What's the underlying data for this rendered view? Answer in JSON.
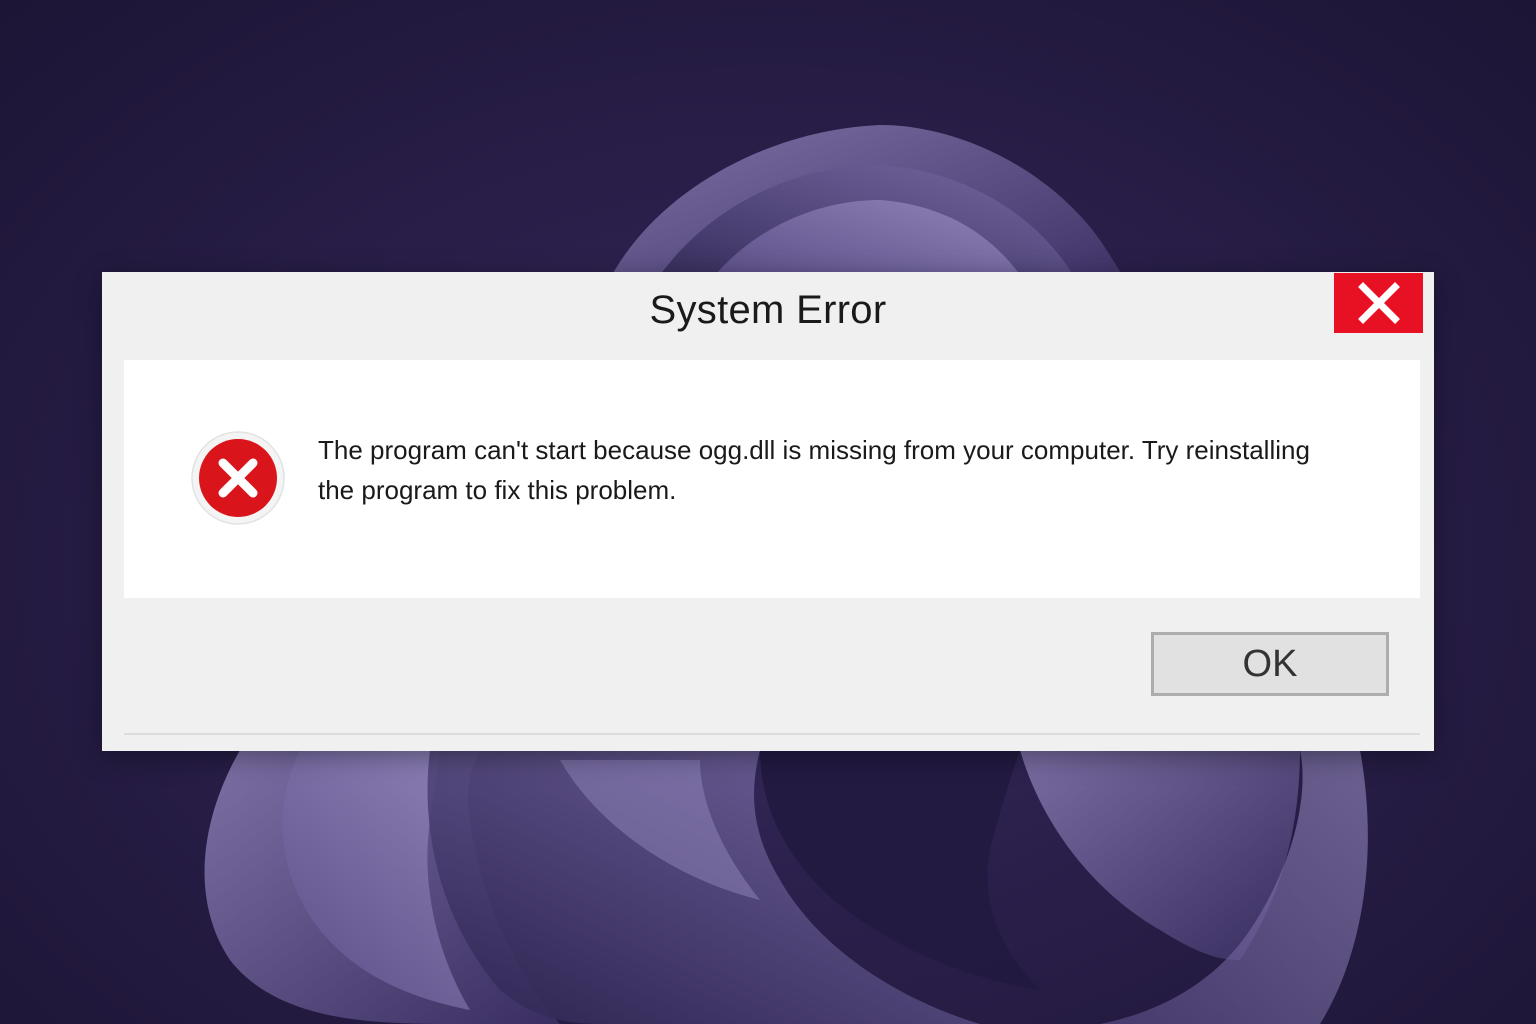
{
  "dialog": {
    "title": "System Error",
    "message": "The program can't start because ogg.dll is missing from your computer. Try reinstalling the program to fix this problem.",
    "ok_label": "OK",
    "icons": {
      "close": "close-icon",
      "error": "error-icon"
    }
  },
  "colors": {
    "close_button": "#e81123",
    "error_icon": "#d9141b",
    "wallpaper_dark": "#1c1535",
    "wallpaper_bloom": "#6a5c95"
  }
}
